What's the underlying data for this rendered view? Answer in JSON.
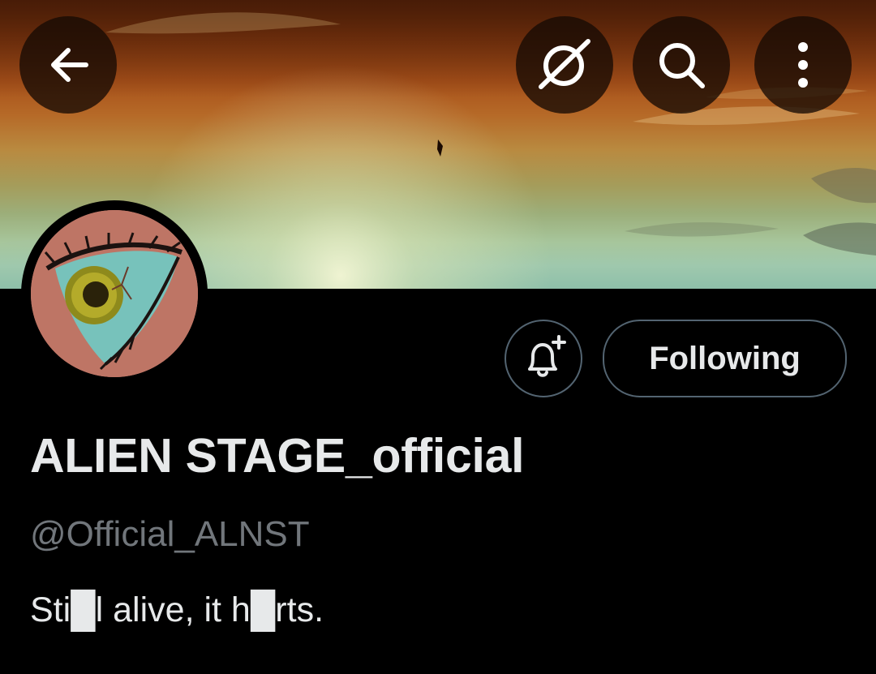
{
  "profile": {
    "display_name": "ALIEN STAGE_official",
    "handle": "@Official_ALNST",
    "bio": "Sti█l alive, it h█rts."
  },
  "actions": {
    "following_label": "Following"
  },
  "icons": {
    "back": "arrow-left",
    "grok": "grok-slash-circle",
    "search": "magnifier",
    "more": "vertical-ellipsis",
    "notify": "bell-plus"
  },
  "colors": {
    "background": "#000000",
    "text_primary": "#e7e9ea",
    "text_secondary": "#71767b",
    "button_border": "#536471",
    "overlay_button": "#160a04"
  }
}
